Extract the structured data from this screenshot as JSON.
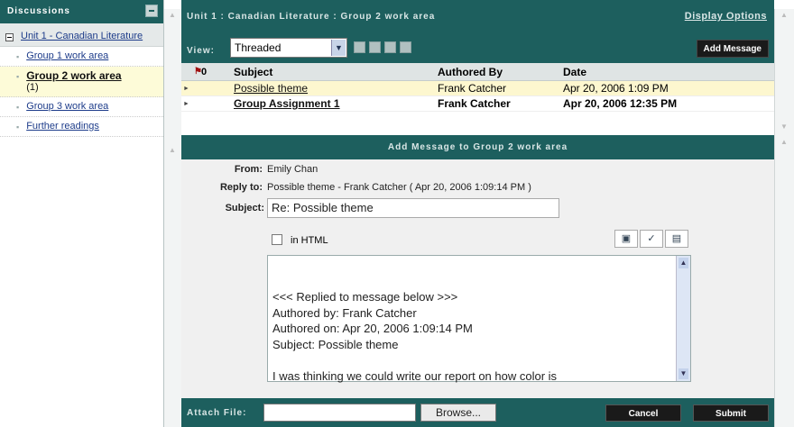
{
  "sidebar": {
    "title": "Discussions",
    "root": "Unit 1 - Canadian Literature",
    "items": [
      {
        "label": "Group 1 work area",
        "count": ""
      },
      {
        "label": "Group 2 work area",
        "count": "(1)"
      },
      {
        "label": "Group 3 work area",
        "count": ""
      },
      {
        "label": "Further readings",
        "count": ""
      }
    ]
  },
  "header": {
    "title": "Unit 1 : Canadian Literature : Group 2 work area",
    "display_options": "Display Options",
    "view_label": "View:",
    "view_value": "Threaded",
    "add_message": "Add Message"
  },
  "table": {
    "flag_count": "0",
    "columns": {
      "subject": "Subject",
      "author": "Authored By",
      "date": "Date"
    },
    "rows": [
      {
        "subject": "Possible theme",
        "author": "Frank Catcher",
        "date": "Apr 20, 2006 1:09 PM"
      },
      {
        "subject": "Group Assignment 1",
        "author": "Frank Catcher",
        "date": "Apr 20, 2006 12:35 PM"
      }
    ]
  },
  "add_panel": {
    "title": "Add Message to Group 2 work area",
    "from_label": "From:",
    "from_value": "Emily Chan",
    "reply_label": "Reply to:",
    "reply_value": "Possible theme - Frank Catcher ( Apr 20, 2006 1:09:14 PM )",
    "subject_label": "Subject:",
    "subject_value": "Re: Possible theme",
    "html_label": "in HTML",
    "editor_text": "<<< Replied to message below >>>\nAuthored by: Frank Catcher\nAuthored on: Apr 20, 2006 1:09:14 PM\nSubject: Possible theme\n\nI was thinking we could write our report on how color is"
  },
  "footer": {
    "attach_label": "Attach File:",
    "browse": "Browse...",
    "cancel": "Cancel",
    "submit": "Submit"
  },
  "colors": {
    "header_teal": "#1d5f5e",
    "selected_row": "#fdf7cf"
  }
}
